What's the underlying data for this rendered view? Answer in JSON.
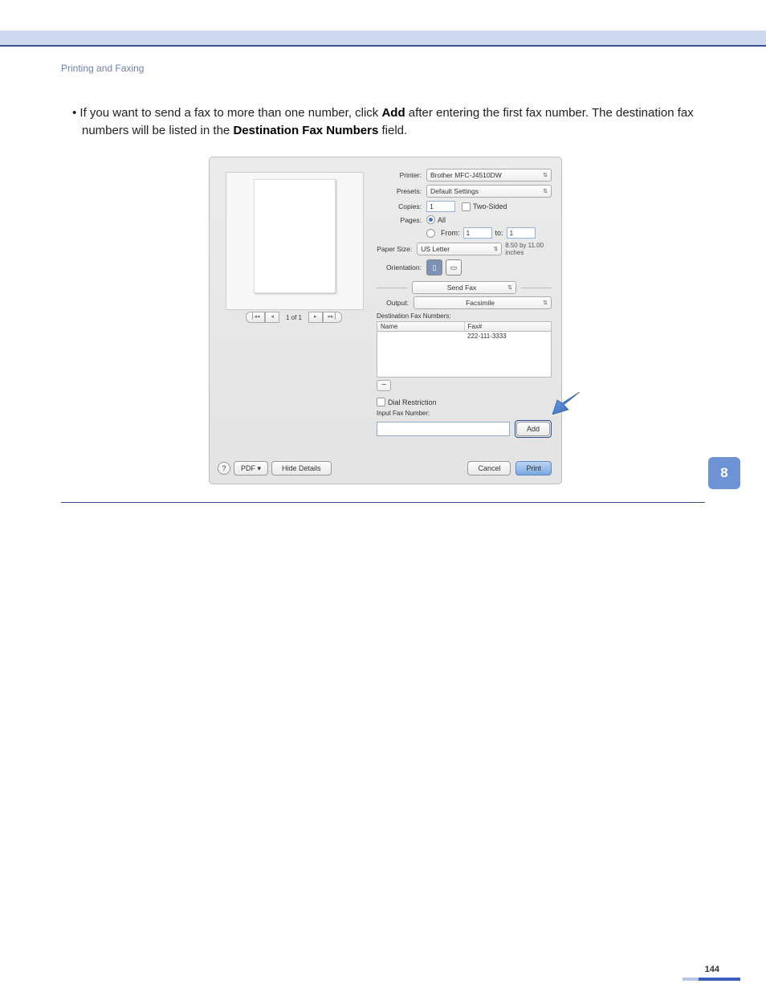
{
  "breadcrumb": "Printing and Faxing",
  "para_before": "If you want to send a fax to more than one number, click ",
  "para_add": "Add",
  "para_mid": " after entering the first fax number. The destination fax numbers will be listed in the ",
  "para_dest": "Destination Fax Numbers",
  "para_after": " field.",
  "dlg": {
    "printer_lbl": "Printer:",
    "printer_val": "Brother MFC-J4510DW",
    "presets_lbl": "Presets:",
    "presets_val": "Default Settings",
    "copies_lbl": "Copies:",
    "copies_val": "1",
    "twosided": "Two-Sided",
    "pages_lbl": "Pages:",
    "all": "All",
    "from": "From:",
    "from_val": "1",
    "to": "to:",
    "to_val": "1",
    "papersize_lbl": "Paper Size:",
    "papersize_val": "US Letter",
    "paperdim": "8.50 by 11.00 inches",
    "orient_lbl": "Orientation:",
    "panel": "Send Fax",
    "output_lbl": "Output:",
    "output_val": "Facsimile",
    "dest_lbl": "Destination Fax Numbers:",
    "col_name": "Name",
    "col_fax": "Fax#",
    "fax_entry": "222-111-3333",
    "dial": "Dial Restriction",
    "inputfax_lbl": "Input Fax Number:",
    "add_btn": "Add",
    "pdf_btn": "PDF ▾",
    "hide_btn": "Hide Details",
    "cancel_btn": "Cancel",
    "print_btn": "Print",
    "pager": "1 of 1"
  },
  "tab": "8",
  "pagenum": "144"
}
